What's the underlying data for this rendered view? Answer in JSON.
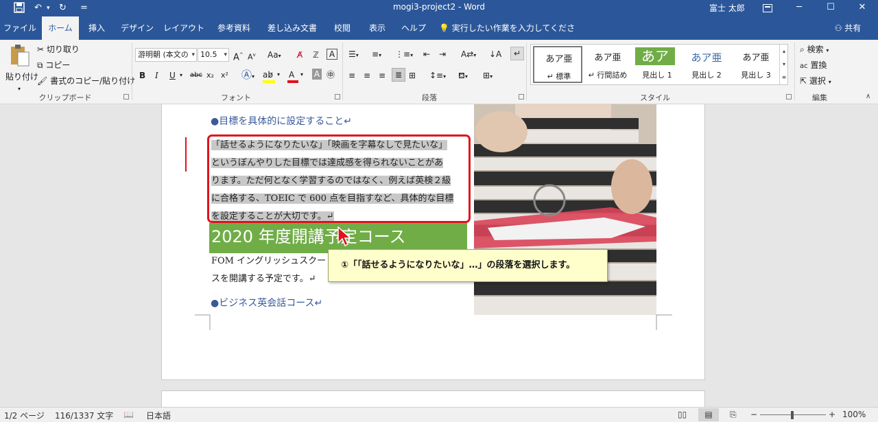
{
  "titlebar": {
    "save_icon": "save-icon",
    "undo_icon": "undo-icon",
    "redo_icon": "redo-icon",
    "qat_more": "=",
    "title": "mogi3-project2  -  Word",
    "user": "富士 太郎",
    "ribbon_display_icon": "ribbon-display-icon",
    "minimize": "─",
    "maximize": "☐",
    "close": "✕"
  },
  "tabs": {
    "file": "ファイル",
    "home": "ホーム",
    "insert": "挿入",
    "design": "デザイン",
    "layout": "レイアウト",
    "references": "参考資料",
    "mailings": "差し込み文書",
    "review": "校閲",
    "view": "表示",
    "help": "ヘルプ",
    "tellme": "実行したい作業を入力してください",
    "share": "共有"
  },
  "clipboard": {
    "paste": "貼り付け",
    "cut": "切り取り",
    "copy": "コピー",
    "format_painter": "書式のコピー/貼り付け",
    "label": "クリップボード"
  },
  "font": {
    "name": "游明朝 (本文の",
    "size": "10.5",
    "label": "フォント",
    "grow": "A",
    "shrink": "A",
    "case": "Aa",
    "bold": "B",
    "italic": "I",
    "underline": "U",
    "strike": "abc",
    "subscript": "x₂",
    "superscript": "x²",
    "highlight_color": "#ffff00",
    "font_color": "#e0121b"
  },
  "paragraph": {
    "label": "段落"
  },
  "styles": {
    "label": "スタイル",
    "items": [
      {
        "sample": "あア亜",
        "name": "↵ 標準"
      },
      {
        "sample": "あア亜",
        "name": "↵ 行間詰め"
      },
      {
        "sample": "あア",
        "name": "見出し 1"
      },
      {
        "sample": "あア亜",
        "name": "見出し 2"
      },
      {
        "sample": "あア亜",
        "name": "見出し 3"
      }
    ],
    "heading1_color": "#70ad47"
  },
  "editing": {
    "find": "検索",
    "replace": "置換",
    "select": "選択",
    "label": "編集"
  },
  "document": {
    "heading_goal": "●目標を具体的に設定すること↵",
    "para_lines": [
      "「話せるようになりたいな」「映画を字幕なしで見たいな」",
      "というぼんやりした目標では達成感を得られないことがあ",
      "ります。ただ何となく学習するのではなく、例えば英検２級",
      "に合格する、TOEIC で 600 点を目指すなど、具体的な目標",
      "を設定することが大切です。↵"
    ],
    "green_heading": "2020 年度開講予定コース",
    "body_line1": "FOM イングリッシュスクー",
    "body_line2": "スを開講する予定です。↵",
    "heading_business": "●ビジネス英会話コース↵"
  },
  "callout": {
    "text": "①「「話せるようになりたいな」…」の段落を選択します。"
  },
  "statusbar": {
    "page": "1/2 ページ",
    "words": "116/1337 文字",
    "language": "日本語",
    "zoom": "100%",
    "zoom_minus": "−",
    "zoom_plus": "+"
  }
}
